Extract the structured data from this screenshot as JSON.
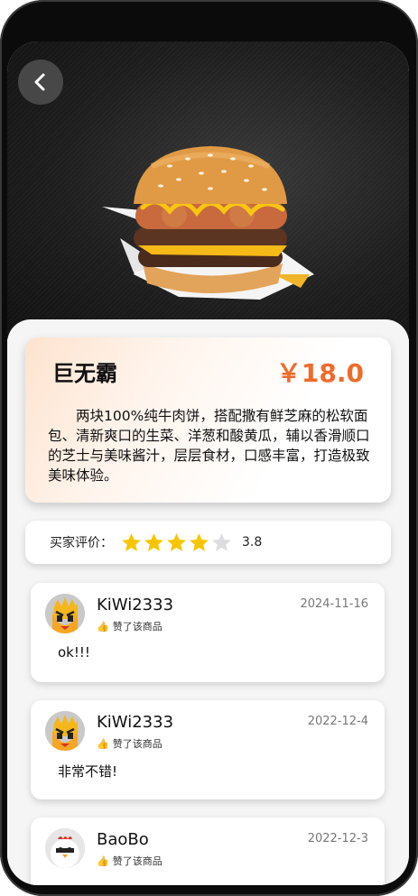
{
  "header": {
    "back_icon": "chevron-left-icon"
  },
  "product": {
    "name": "巨无霸",
    "price": "￥18.0",
    "description": "两块100%纯牛肉饼，搭配撒有鲜芝麻的松软面包、清新爽口的生菜、洋葱和酸黄瓜，辅以香滑顺口的芝士与美味酱汁，层层食材，口感丰富，打造极致美味体验。"
  },
  "rating": {
    "label": "买家评价：",
    "value": "3.8",
    "stars_filled": 4,
    "stars_total": 5,
    "star_color": "#f7c600",
    "star_empty_color": "#dddddd"
  },
  "reviews": [
    {
      "username": "KiWi2333",
      "date": "2024-11-16",
      "liked_text": "赞了该商品",
      "comment": "ok!!!",
      "avatar": "fries-character-avatar"
    },
    {
      "username": "KiWi2333",
      "date": "2022-12-4",
      "liked_text": "赞了该商品",
      "comment": "非常不错!",
      "avatar": "fries-character-avatar"
    },
    {
      "username": "BaoBo",
      "date": "2022-12-3",
      "liked_text": "赞了该商品",
      "comment": "",
      "avatar": "chicken-character-avatar"
    }
  ],
  "colors": {
    "accent": "#f06a2a",
    "hero_bg": "#1e1e1e"
  }
}
